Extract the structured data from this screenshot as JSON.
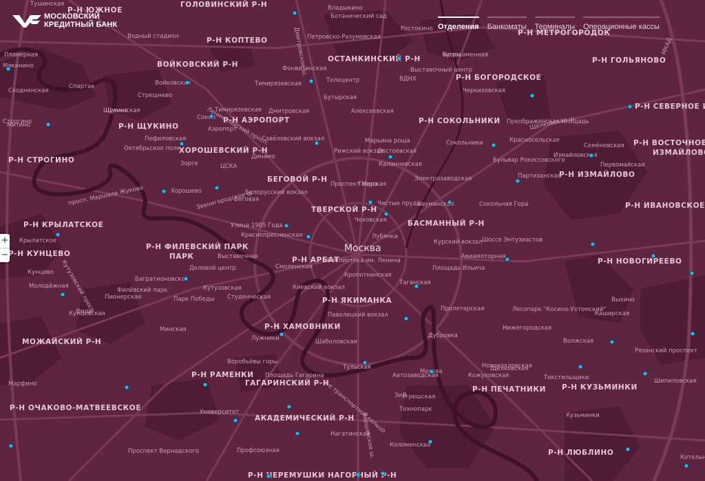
{
  "header": {
    "logo_line1": "МОСКОВСКИЙ",
    "logo_line2": "КРЕДИТНЫЙ БАНК",
    "tabs": [
      {
        "label": "Отделения",
        "active": true
      },
      {
        "label": "Банкоматы",
        "active": false
      },
      {
        "label": "Терминалы",
        "active": false
      },
      {
        "label": "Операционные кассы",
        "active": false
      }
    ]
  },
  "zoom": {
    "in_label": "+",
    "out_label": "−"
  },
  "colors": {
    "map_bg": "#5e2440",
    "pin": "#2fb8ec",
    "road": "#7d3c59",
    "river": "#3e1229",
    "park": "#4c1a34"
  },
  "city_label": "Москва",
  "districts": [
    "Р-Н КОПТЕВО",
    "ВОЙКОВСКИЙ Р-Н",
    "ОСТАНКИНСКИЙ Р-Н",
    "Р-Н МЕТРОГОРОДОК",
    "Р-Н ГОЛЬЯНОВО",
    "Р-Н БОГОРОДСКОЕ",
    "Р-Н АЭРОПОРТ",
    "Р-Н СОКОЛЬНИКИ",
    "Р-Н СЕВЕРНОЕ ИЗМАЙЛОВО",
    "Р-Н ЩУКИНО",
    "ХОРОШЕВСКИЙ Р-Н",
    "Р-Н ВОСТОЧНОЕ ИЗМАЙЛОВО",
    "Р-Н СТРОГИНО",
    "БЕГОВОЙ Р-Н",
    "Р-Н ИЗМАЙЛОВО",
    "ТВЕРСКОЙ Р-Н",
    "Р-Н ИВАНОВСКОЕ",
    "Р-Н КРЫЛАТСКОЕ",
    "БАСМАННЫЙ Р-Н",
    "Р-Н ФИЛЕВСКИЙ ПАРК",
    "Р-Н КУНЦЕВО",
    "Р-Н АРБАТ",
    "Р-Н НОВОГИРЕЕВО",
    "Р-Н ЯКИМАНКА",
    "Р-Н ХАМОВНИКИ",
    "МОЖАЙСКИЙ Р-Н",
    "Р-Н РАМЕНКИ",
    "ГАГАРИНСКИЙ Р-Н",
    "Р-Н ПЕЧАТНИКИ",
    "Р-Н КУЗЬМИНКИ",
    "Р-Н ОЧАКОВО-МАТВЕЕВСКОЕ",
    "АКАДЕМИЧЕСКИЙ Р-Н",
    "Р-Н ЛЮБЛИНО",
    "Р-Н ЧЕРЕМУШКИ",
    "НАГОРНЫЙ Р-Н",
    "Р-Н ЮЖНОЕ",
    "ГОЛОВИНСКИЙ Р-Н"
  ],
  "district_extra": [
    "ПАРК",
    "ИЗМАЙЛОВО"
  ],
  "places": [
    "Водный стадион",
    "Войковская",
    "Стрешнево",
    "Щукинская",
    "Октябрьское поле",
    "Пефиловская",
    "Зорге",
    "Хорошево",
    "Беговая",
    "ЦСКА",
    "Динамо",
    "Савёловский вокзал",
    "Дмитровская",
    "Бутырская",
    "Тимирязевская",
    "Фонвизинская",
    "Марьина роща",
    "Рижский вокзал",
    "Алексеевская",
    "Белорусский вокзал",
    "Улица 1905 Года",
    "Краснопресненская",
    "Выставочная",
    "Деловой центр",
    "Кутузовская",
    "Студенческая",
    "Киевский вокзал",
    "Смоленская",
    "Библиотека им. Ленина",
    "Кропоткинская",
    "Павелецкий вокзал",
    "Таганская",
    "Пролетарская",
    "Дубровка",
    "Кожуховская",
    "Автозаводская",
    "Тульская",
    "Шаболовская",
    "Лужники",
    "Воробьёвы горы",
    "Площадь Гагарина",
    "Университет",
    "Проспект Вернадского",
    "Профсоюзная",
    "Нагатинская",
    "Коломенская",
    "Технопарк",
    "ЗиЛ",
    "Кунцевская",
    "Пионерская",
    "Багратионовская",
    "Филёвский парк",
    "Парк Победы",
    "Минская",
    "Марфино",
    "Молодёжная",
    "Крылатское",
    "Сокольники",
    "Электрозаводская",
    "Бауманская",
    "Сокольная Гора",
    "Шоссе Энтузиастов",
    "Авиамоторная",
    "Площадь Ильича",
    "Курский вокзал",
    "Чистые пруды",
    "Лубянка",
    "Чеховская",
    "Тверская",
    "Проспект Мира",
    "Достоевская",
    "Каланчевская",
    "Красносельская",
    "Преображенская площадь",
    "Черкизовская",
    "Бульвар Рокоссовского",
    "Измайловская",
    "Партизанская",
    "Семёновская",
    "Первомайская",
    "Щёлковская",
    "Текстильщики",
    "Кузьминки",
    "Волжская",
    "Рязанский проспект",
    "Выхино",
    "Лесопарк \"Косино-Ухтомский\"",
    "Нижегородская",
    "Новохохловская",
    "Угрешская",
    "Москва",
    "Каширская",
    "Шипиловская",
    "Котельники",
    "Спартак",
    "Сокол",
    "Аэропорт",
    "Петровско-Разумовская",
    "Владыкино",
    "Ботанический сад",
    "Ростокино",
    "Белокаменная",
    "ВДНХ",
    "Телецентр",
    "Выставочный центр",
    "Бугры",
    "Щукино",
    "Строгино",
    "Тушинская",
    "Мякинино",
    "Сходненская",
    "Планерная",
    "Митино",
    "Кунцево",
    "Фили",
    "Тимирязевская"
  ],
  "road_labels": [
    "просп. Маршала Жукова",
    "Звенигородское ш.",
    "Щёлковское ш.",
    "МКАД",
    "3-е транспортное кольцо",
    "Варшавское ш.",
    "Кутузовский просп.",
    "Дмитровское ш.",
    "Ленинградский просп."
  ],
  "pins_count": 70
}
